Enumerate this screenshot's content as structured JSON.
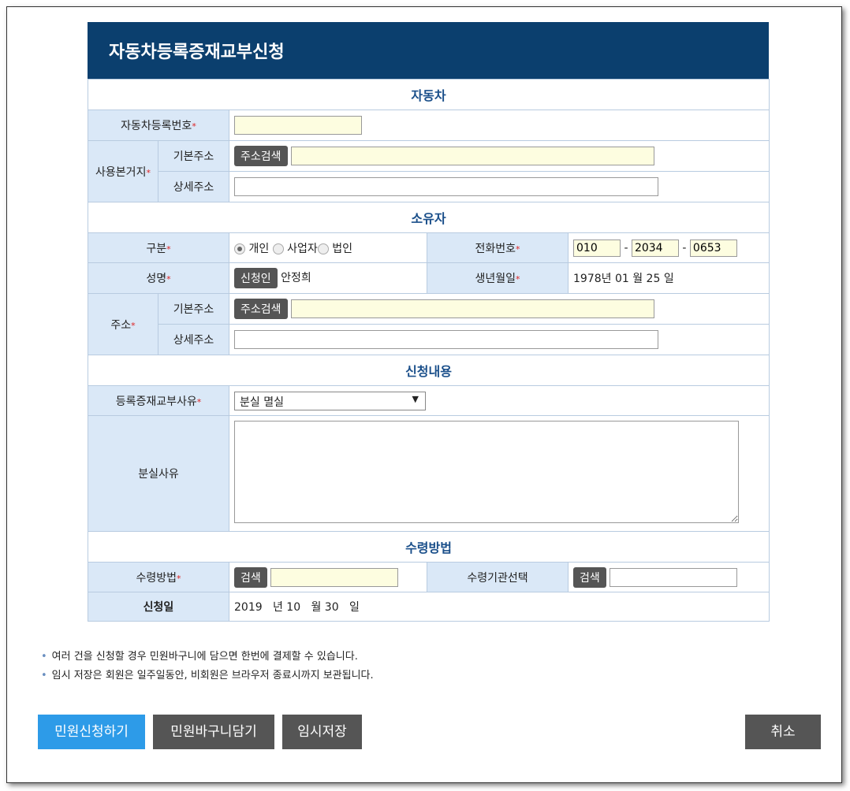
{
  "title": "자동차등록증재교부신청",
  "sections": {
    "car": "자동차",
    "owner": "소유자",
    "content": "신청내용",
    "receipt": "수령방법"
  },
  "car": {
    "reg_no_label": "자동차등록번호",
    "reg_no_value": "",
    "residence_label": "사용본거지",
    "basic_addr_label": "기본주소",
    "detail_addr_label": "상세주소",
    "search_btn": "주소검색"
  },
  "owner": {
    "type_label": "구분",
    "types": [
      "개인",
      "사업자",
      "법인"
    ],
    "selected_type": "개인",
    "phone_label": "전화번호",
    "phone": [
      "010",
      "2034",
      "0653"
    ],
    "name_label": "성명",
    "name_btn": "신청인",
    "name_value": "안정희",
    "birth_label": "생년월일",
    "birth_value": "1978년 01 월 25 일",
    "addr_label": "주소",
    "basic_addr_label": "기본주소",
    "detail_addr_label": "상세주소",
    "search_btn": "주소검색"
  },
  "content": {
    "reason_label": "등록증재교부사유",
    "reason_value": "분실 멸실",
    "loss_label": "분실사유",
    "loss_value": ""
  },
  "receipt": {
    "method_label": "수령방법",
    "method_btn": "검색",
    "org_label": "수령기관선택",
    "org_btn": "검색",
    "date_label": "신청일",
    "date_value": "2019   년 10   월 30   일"
  },
  "notes": [
    "여러 건을 신청할 경우 민원바구니에 담으면 한번에 결제할 수 있습니다.",
    "임시 저장은 회원은 일주일동안, 비회원은 브라우저 종료시까지 보관됩니다."
  ],
  "buttons": {
    "apply": "민원신청하기",
    "basket": "민원바구니담기",
    "save": "임시저장",
    "cancel": "취소"
  },
  "required_mark": "*",
  "colors": {
    "header": "#0b3f6e",
    "label_bg": "#dae8f7",
    "primary": "#2d9be8",
    "secondary": "#555555"
  }
}
